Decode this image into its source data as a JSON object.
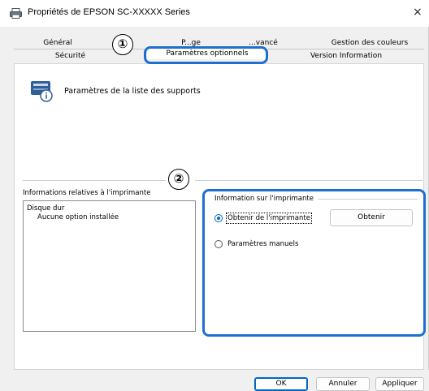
{
  "window": {
    "title": "Propriétés de EPSON SC-XXXXX Series",
    "close_glyph": "×"
  },
  "tabs": {
    "row_back": [
      "Général",
      "P...ge",
      "...vancé",
      "Gestion des couleurs"
    ],
    "row_front": [
      "Sécurité",
      "Paramètres optionnels",
      "Version Information"
    ],
    "active": "Paramètres optionnels"
  },
  "media": {
    "label": "Paramètres de la liste des supports",
    "icon": "printer-info-icon"
  },
  "printer_info": {
    "section_label": "Informations relatives à l'imprimante",
    "list": [
      "Disque dur",
      "Aucune option installée"
    ],
    "box_title": "Information sur l'imprimante",
    "option_obtain": "Obtenir de l'imprimante",
    "option_manual": "Paramètres manuels",
    "obtain_button": "Obtenir",
    "selected": "Obtenir de l'imprimante"
  },
  "markers": [
    "①",
    "②"
  ],
  "buttons": {
    "ok": "OK",
    "cancel": "Annuler",
    "apply": "Appliquer"
  },
  "colors": {
    "callout": "#1f6fd1",
    "accent": "#0067c0"
  }
}
